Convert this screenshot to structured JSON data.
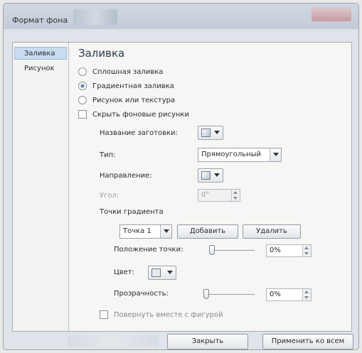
{
  "window": {
    "title": "Формат фона"
  },
  "nav": {
    "items": [
      {
        "label": "Заливка",
        "active": true
      },
      {
        "label": "Рисунок",
        "active": false
      }
    ]
  },
  "fill": {
    "section_title": "Заливка",
    "options": [
      {
        "label": "Сплошная заливка",
        "checked": false
      },
      {
        "label": "Градиентная заливка",
        "checked": true
      },
      {
        "label": "Рисунок или текстура",
        "checked": false
      }
    ],
    "hide_bg_label": "Скрыть фоновые рисунки",
    "preset_label": "Название заготовки:",
    "type_label": "Тип:",
    "type_value": "Прямоугольный",
    "direction_label": "Направление:",
    "angle_label": "Угол:",
    "angle_value": "0°",
    "stops_label": "Точки градиента",
    "stop_value": "Точка 1",
    "add_label": "Добавить",
    "remove_label": "Удалить",
    "position_label": "Положение точки:",
    "position_value": "0%",
    "position_fraction": 0,
    "color_label": "Цвет:",
    "transparency_label": "Прозрачность:",
    "transparency_value": "0%",
    "transparency_fraction": 0,
    "rotate_label": "Повернуть вместе с фигурой"
  },
  "footer": {
    "close_label": "Закрыть",
    "apply_all_label": "Применить ко всем"
  }
}
